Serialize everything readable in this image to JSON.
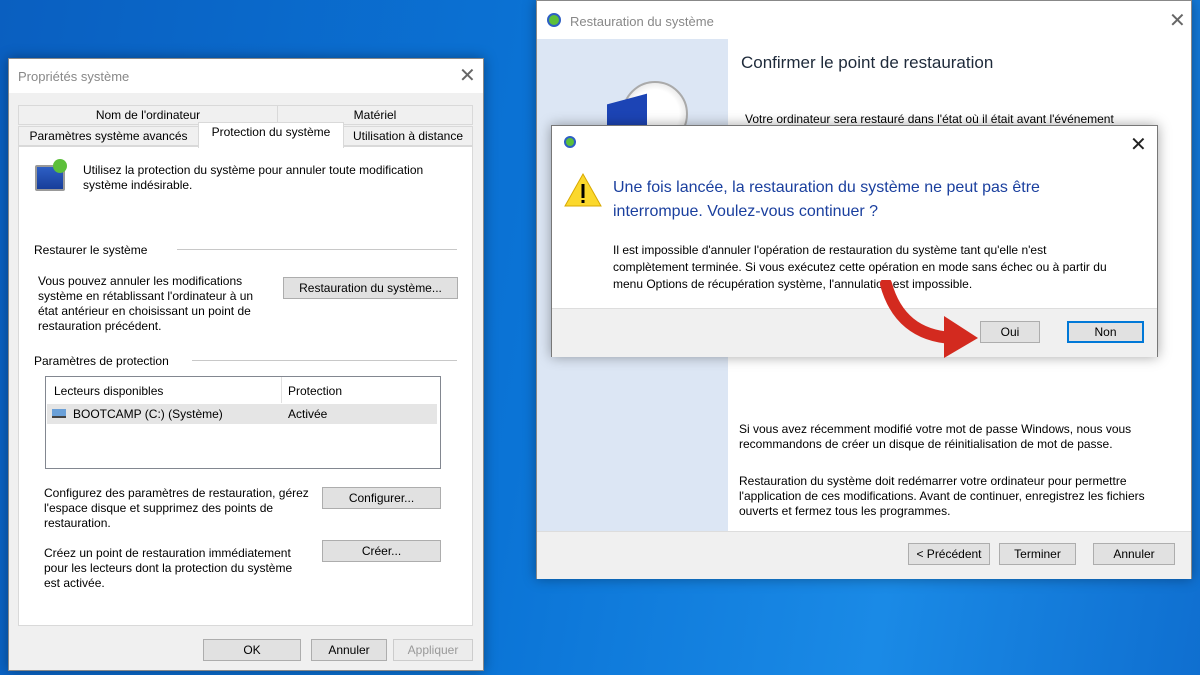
{
  "props": {
    "title": "Propriétés système",
    "tabs_row1": [
      "Nom de l'ordinateur",
      "Matériel"
    ],
    "tabs_row2": [
      "Paramètres système avancés",
      "Protection du système",
      "Utilisation à distance"
    ],
    "intro": "Utilisez la protection du système pour annuler toute modification système indésirable.",
    "restore_group": "Restaurer le système",
    "restore_text": "Vous pouvez annuler les modifications système en rétablissant l'ordinateur à un état antérieur en choisissant un point de restauration précédent.",
    "restore_button": "Restauration du système...",
    "protect_group": "Paramètres de protection",
    "col_drives": "Lecteurs disponibles",
    "col_protection": "Protection",
    "drive_name": "BOOTCAMP (C:) (Système)",
    "drive_status": "Activée",
    "config_text": "Configurez des paramètres de restauration, gérez l'espace disque et supprimez des points de restauration.",
    "config_button": "Configurer...",
    "create_text": "Créez un point de restauration immédiatement pour les lecteurs dont la protection du système est activée.",
    "create_button": "Créer...",
    "ok": "OK",
    "cancel": "Annuler",
    "apply": "Appliquer"
  },
  "wizard": {
    "title": "Restauration du système",
    "heading": "Confirmer le point de restauration",
    "line1": "Votre ordinateur sera restauré dans l'état où il était avant l'événement",
    "password_note": "Si vous avez récemment modifié votre mot de passe Windows, nous vous recommandons de créer un disque de réinitialisation de mot de passe.",
    "restart_note": "Restauration du système doit redémarrer votre ordinateur pour permettre l'application de ces modifications. Avant de continuer, enregistrez les fichiers ouverts et fermez tous les programmes.",
    "back": "< Précédent",
    "finish": "Terminer",
    "cancel": "Annuler"
  },
  "modal": {
    "question": "Une fois lancée, la restauration du système ne peut pas être interrompue. Voulez-vous continuer ?",
    "detail": "Il est impossible d'annuler l'opération de restauration du système tant qu'elle n'est complètement terminée. Si vous exécutez cette opération en mode sans échec ou à partir du menu Options de récupération système, l'annulation est impossible.",
    "yes": "Oui",
    "no": "Non"
  },
  "colors": {
    "question": "#1a3f9e",
    "arrow": "#d32a1f",
    "accent": "#0078d7"
  }
}
